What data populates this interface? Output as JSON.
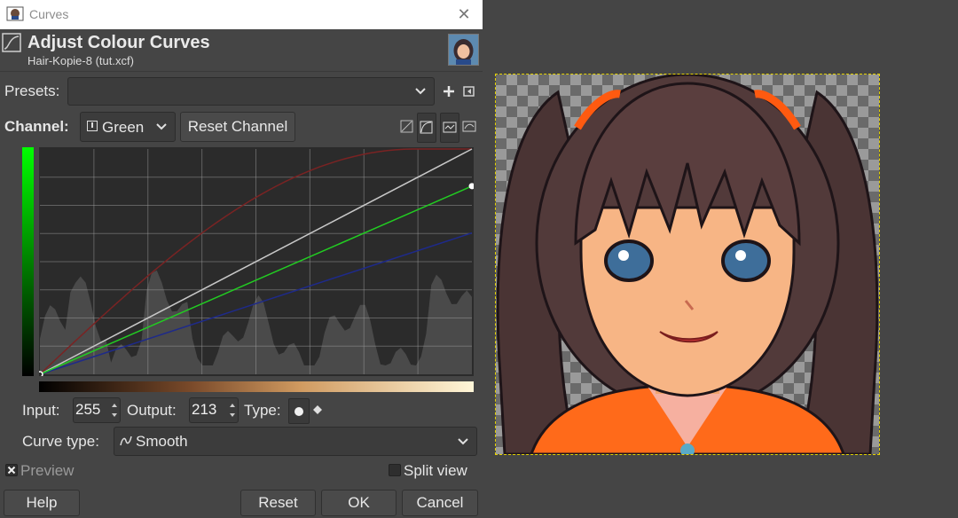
{
  "window": {
    "title": "Curves",
    "close_label": "✕"
  },
  "header": {
    "title": "Adjust Colour Curves",
    "subtitle": "Hair-Kopie-8 (tut.xcf)"
  },
  "presets": {
    "label": "Presets:",
    "value": ""
  },
  "channel": {
    "label": "Channel:",
    "value": "Green",
    "reset_label": "Reset Channel"
  },
  "inputs": {
    "input_label": "Input:",
    "input_value": "255",
    "output_label": "Output:",
    "output_value": "213",
    "type_label": "Type:"
  },
  "curve_type": {
    "label": "Curve type:",
    "value": "Smooth"
  },
  "preview": {
    "label": "Preview",
    "checked": true
  },
  "split_view": {
    "label": "Split view",
    "checked": false
  },
  "buttons": {
    "help": "Help",
    "reset": "Reset",
    "ok": "OK",
    "cancel": "Cancel"
  },
  "colors": {
    "grid": "#9a9a9a",
    "diag": "#c8c8c8",
    "green_curve": "#22cc22",
    "red_curve": "#7a2323",
    "blue_curve": "#1e2a8a",
    "histogram": "#4a4a4a"
  },
  "curves": {
    "green_output_end": 213,
    "blue_output_end": 160,
    "red_peak_output": 255
  }
}
